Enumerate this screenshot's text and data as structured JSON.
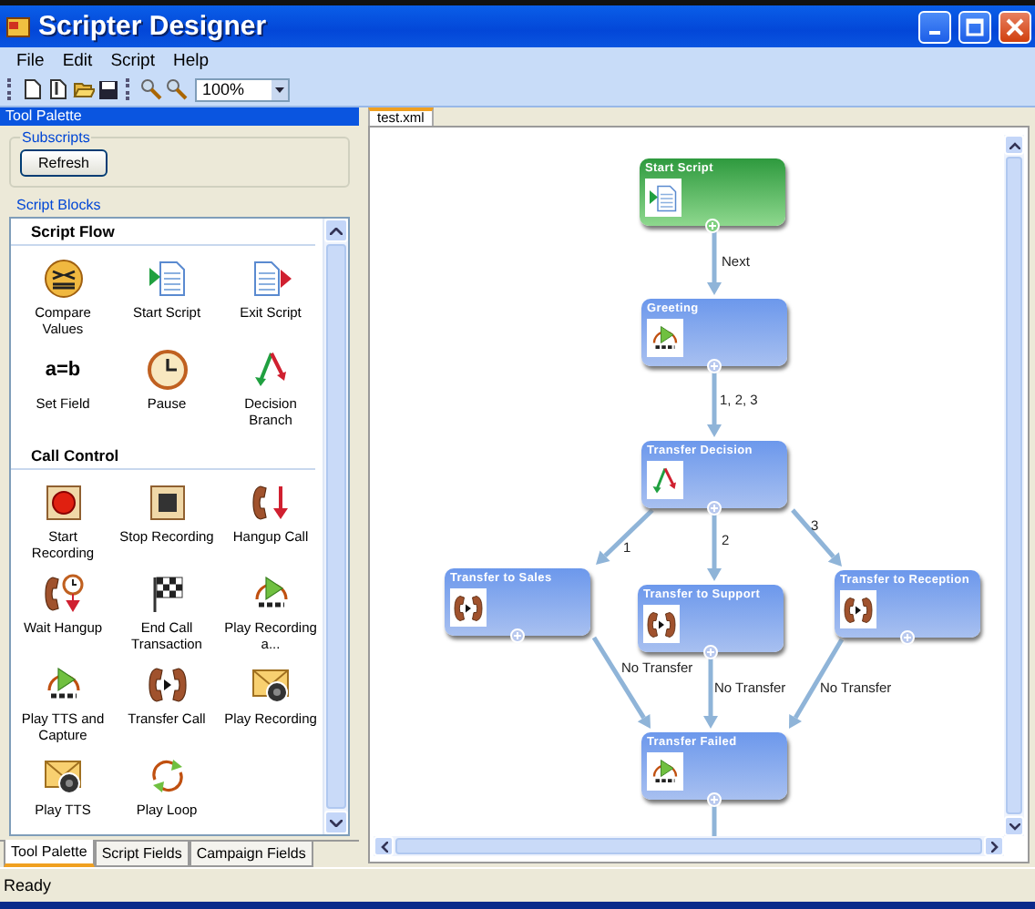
{
  "window": {
    "title": "Scripter Designer"
  },
  "menu": [
    "File",
    "Edit",
    "Script",
    "Help"
  ],
  "toolbar": {
    "zoom": "100%"
  },
  "tool_palette": {
    "title": "Tool Palette",
    "subscripts": {
      "label": "Subscripts",
      "button": "Refresh"
    },
    "blocks_label": "Script Blocks",
    "sections": [
      {
        "title": "Script Flow",
        "items": [
          {
            "label": "Compare Values"
          },
          {
            "label": "Start Script"
          },
          {
            "label": "Exit Script"
          },
          {
            "label": "Set Field",
            "glyph": "a=b"
          },
          {
            "label": "Pause"
          },
          {
            "label": "Decision Branch"
          }
        ]
      },
      {
        "title": "Call Control",
        "items": [
          {
            "label": "Start Recording"
          },
          {
            "label": "Stop Recording"
          },
          {
            "label": "Hangup Call"
          },
          {
            "label": "Wait Hangup"
          },
          {
            "label": "End Call Transaction"
          },
          {
            "label": "Play Recording a..."
          },
          {
            "label": "Play TTS and Capture"
          },
          {
            "label": "Transfer Call"
          },
          {
            "label": "Play Recording"
          },
          {
            "label": "Play TTS"
          },
          {
            "label": "Play Loop"
          }
        ]
      }
    ]
  },
  "bottom_tabs": [
    {
      "label": "Tool Palette",
      "selected": true
    },
    {
      "label": "Script Fields",
      "selected": false
    },
    {
      "label": "Campaign Fields",
      "selected": false
    }
  ],
  "document_tabs": [
    {
      "label": "test.xml",
      "selected": true
    }
  ],
  "diagram": {
    "nodes": [
      {
        "title": "Start Script",
        "kind": "start"
      },
      {
        "title": "Greeting",
        "kind": "block"
      },
      {
        "title": "Transfer Decision",
        "kind": "block"
      },
      {
        "title": "Transfer to Sales",
        "kind": "block"
      },
      {
        "title": "Transfer to Support",
        "kind": "block"
      },
      {
        "title": "Transfer to Reception",
        "kind": "block"
      },
      {
        "title": "Transfer Failed",
        "kind": "block"
      }
    ],
    "edges": [
      {
        "label": "Next"
      },
      {
        "label": "1, 2, 3"
      },
      {
        "label": "1"
      },
      {
        "label": "2"
      },
      {
        "label": "3"
      },
      {
        "label": "No Transfer"
      },
      {
        "label": "No Transfer"
      },
      {
        "label": "No Transfer"
      }
    ]
  },
  "status_bar": "Ready"
}
